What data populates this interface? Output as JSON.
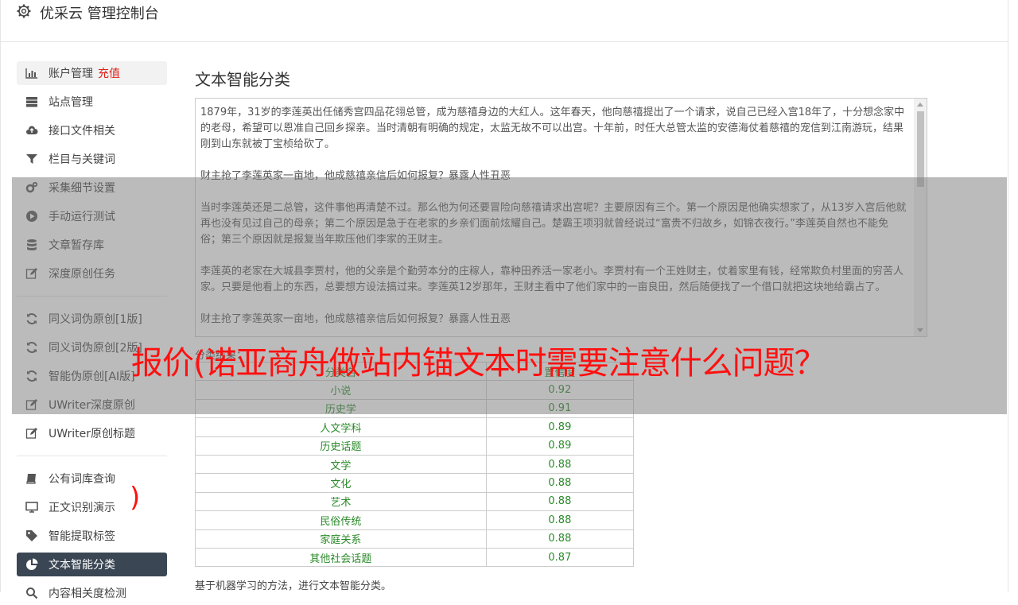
{
  "app": {
    "title": "优采云 管理控制台"
  },
  "sidebar": {
    "groups": [
      [
        {
          "label": "账户管理",
          "extra": "充值",
          "icon": "bar-chart-icon"
        },
        {
          "label": "站点管理",
          "icon": "server-icon"
        },
        {
          "label": "接口文件相关",
          "icon": "cloud-upload-icon"
        },
        {
          "label": "栏目与关键词",
          "icon": "filter-icon"
        },
        {
          "label": "采集细节设置",
          "icon": "gears-icon"
        },
        {
          "label": "手动运行测试",
          "icon": "play-circle-icon"
        },
        {
          "label": "文章暂存库",
          "icon": "database-icon"
        },
        {
          "label": "深度原创任务",
          "icon": "edit-icon"
        }
      ],
      [
        {
          "label": "同义词伪原创[1版]",
          "icon": "refresh-icon"
        },
        {
          "label": "同义词伪原创[2版]",
          "icon": "refresh-icon"
        },
        {
          "label": "智能伪原创[AI版]",
          "icon": "refresh-icon"
        },
        {
          "label": "UWriter深度原创",
          "icon": "edit-icon"
        },
        {
          "label": "UWriter原创标题",
          "icon": "edit-icon"
        }
      ],
      [
        {
          "label": "公有词库查询",
          "icon": "book-icon"
        },
        {
          "label": "正文识别演示",
          "icon": "monitor-icon"
        },
        {
          "label": "智能提取标签",
          "icon": "tag-icon"
        },
        {
          "label": "文本智能分类",
          "icon": "pie-chart-icon"
        },
        {
          "label": "内容相关度检测",
          "icon": "search-icon"
        }
      ]
    ]
  },
  "main": {
    "title": "文本智能分类",
    "text_paragraphs": [
      "1879年，31岁的李莲英出任储秀宫四品花翎总管，成为慈禧身边的大红人。这年春天，他向慈禧提出了一个请求，说自己已经入宫18年了，十分想念家中的老母，希望可以恩准自己回乡探亲。当时清朝有明确的规定，太监无故不可以出宫。十年前，时任大总管太监的安德海仗着慈禧的宠信到江南游玩，结果刚到山东就被丁宝桢给砍了。",
      "财主抢了李莲英家一亩地，他成慈禧亲信后如何报复？暴露人性丑恶",
      "当时李莲英还是二总管，这件事他再清楚不过。那么他为何还要冒险向慈禧请求出宫呢？主要原因有三个。第一个原因是他确实想家了，从13岁入宫后他就再也没有见过自己的母亲；第二个原因是急于在老家的乡亲们面前炫耀自己。楚霸王项羽就曾经说过“富贵不归故乡，如锦衣夜行。”李莲英自然也不能免俗；第三个原因就是报复当年欺压他们李家的王财主。",
      "李莲英的老家在大城县李贾村，他的父亲是个勤劳本分的庄稼人，靠种田养活一家老小。李贾村有一个王姓财主，仗着家里有钱，经常欺负村里面的穷苦人家。只要是他看上的东西，总要想方设法搞过来。李莲英12岁那年，王财主看中了他们家中的一亩良田，然后随便找了一个借口就把这块地给霸占了。",
      "财主抢了李莲英家一亩地，他成慈禧亲信后如何报复？暴露人性丑恶"
    ],
    "result_label": "分类结果：",
    "table": {
      "headers": [
        "分类名",
        "置信度"
      ],
      "rows": [
        [
          "小说",
          "0.92"
        ],
        [
          "历史学",
          "0.91"
        ],
        [
          "人文学科",
          "0.89"
        ],
        [
          "历史话题",
          "0.89"
        ],
        [
          "文学",
          "0.88"
        ],
        [
          "文化",
          "0.88"
        ],
        [
          "艺术",
          "0.88"
        ],
        [
          "民俗传统",
          "0.88"
        ],
        [
          "家庭关系",
          "0.88"
        ],
        [
          "其他社会话题",
          "0.87"
        ]
      ]
    },
    "footnote": "基于机器学习的方法，进行文本智能分类。"
  },
  "overlay": {
    "headline": "报价(诺亚商舟做站内锚文本时需要注意什么问题？",
    "paren": ")"
  }
}
